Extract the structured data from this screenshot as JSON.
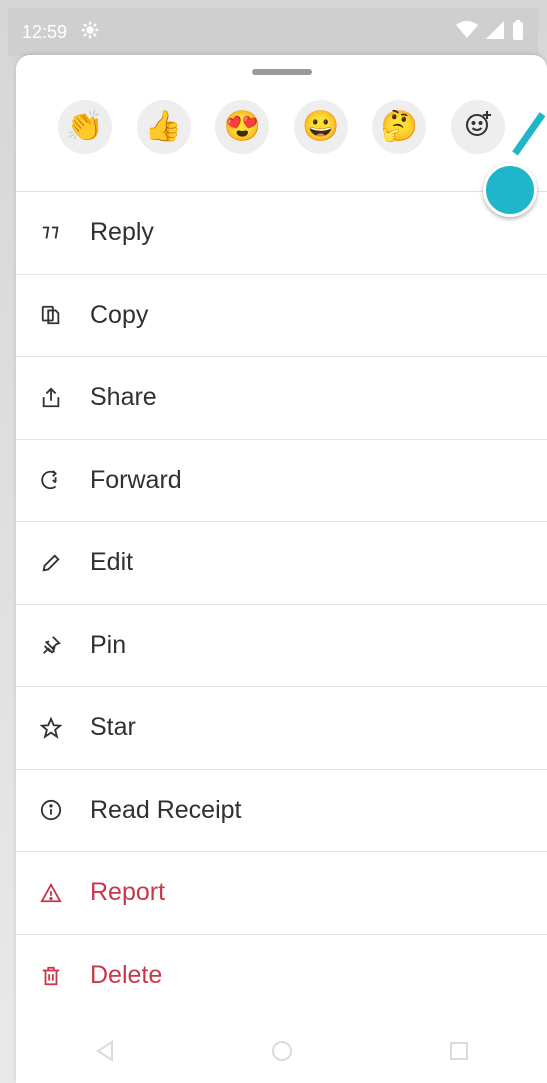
{
  "status_bar": {
    "time": "12:59"
  },
  "reactions": [
    {
      "emoji": "👏",
      "name": "clap"
    },
    {
      "emoji": "👍",
      "name": "thumbs-up"
    },
    {
      "emoji": "😍",
      "name": "heart-eyes"
    },
    {
      "emoji": "😀",
      "name": "grinning"
    },
    {
      "emoji": "🤔",
      "name": "thinking"
    }
  ],
  "menu": {
    "reply": "Reply",
    "copy": "Copy",
    "share": "Share",
    "forward": "Forward",
    "edit": "Edit",
    "pin": "Pin",
    "star": "Star",
    "read_receipt": "Read Receipt",
    "report": "Report",
    "delete": "Delete"
  },
  "colors": {
    "danger": "#c8384a",
    "accent": "#1fb6c9"
  }
}
